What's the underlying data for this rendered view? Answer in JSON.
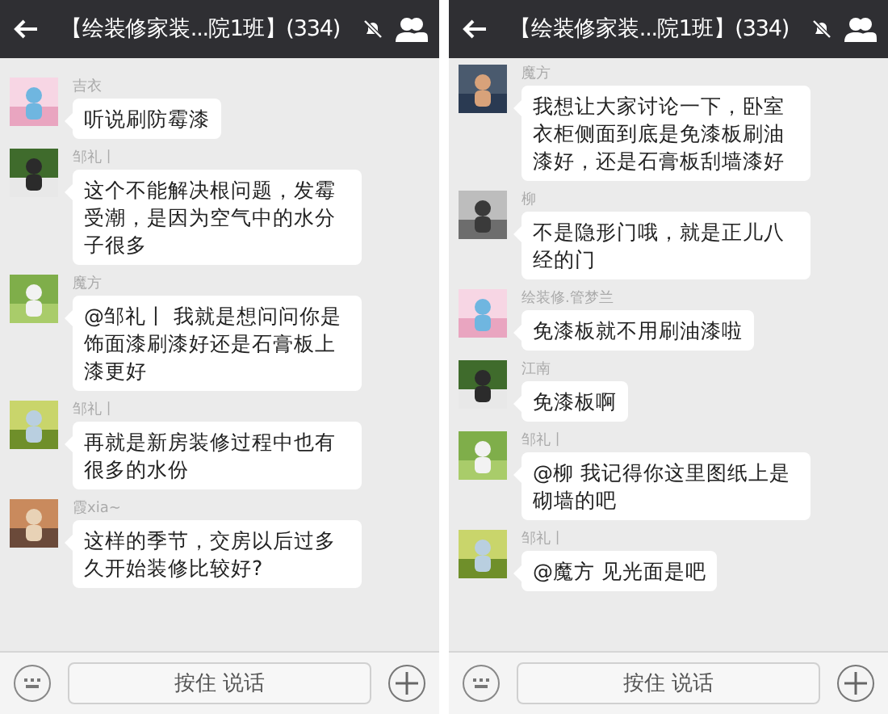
{
  "panels": [
    {
      "header": {
        "title": "【绘装修家装...院1班】(334)"
      },
      "messages": [
        {
          "sender": "吉衣",
          "text": "听说刷防霉漆"
        },
        {
          "sender": "邹礼丨",
          "text": "这个不能解决根问题，发霉受潮，是因为空气中的水分子很多"
        },
        {
          "sender": "魔方",
          "text": "@邹礼丨 我就是想问问你是饰面漆刷漆好还是石膏板上漆更好"
        },
        {
          "sender": "邹礼丨",
          "text": "再就是新房装修过程中也有很多的水份"
        },
        {
          "sender": "霞xia~",
          "text": "这样的季节，交房以后过多久开始装修比较好?"
        }
      ],
      "input_bar": {
        "hold_to_talk": "按住 说话"
      }
    },
    {
      "header": {
        "title": "【绘装修家装...院1班】(334)"
      },
      "messages": [
        {
          "sender": "魔方",
          "text": "我想让大家讨论一下，卧室衣柜侧面到底是免漆板刷油漆好，还是石膏板刮墙漆好"
        },
        {
          "sender": "柳",
          "text": "不是隐形门哦，就是正儿八经的门"
        },
        {
          "sender": "绘装修.管梦兰",
          "text": "免漆板就不用刷油漆啦"
        },
        {
          "sender": "江南",
          "text": "免漆板啊"
        },
        {
          "sender": "邹礼丨",
          "text": "@柳 我记得你这里图纸上是砌墙的吧"
        },
        {
          "sender": "邹礼丨",
          "text": "@魔方 见光面是吧"
        }
      ],
      "input_bar": {
        "hold_to_talk": "按住 说话"
      }
    }
  ]
}
